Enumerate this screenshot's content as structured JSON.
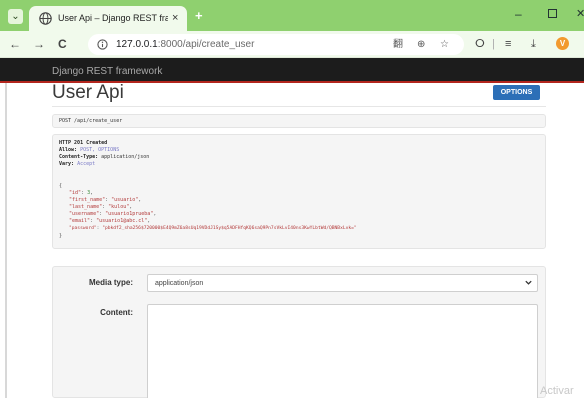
{
  "browser": {
    "tab_menu_glyph": "⌄",
    "tab_title": "User Api – Django REST framew",
    "tab_close": "×",
    "new_tab": "+",
    "window": {
      "minimize": "–",
      "close": "✕"
    },
    "nav": {
      "back": "←",
      "forward": "→",
      "reload": "C"
    },
    "url_host": "127.0.0.1",
    "url_rest": ":8000/api/create_user",
    "toolbar_icons": {
      "translate": "翻",
      "zoom": "⊕",
      "bookmark": "☆",
      "extensions": "ⵔ",
      "separator": "|",
      "reading_list": "≡",
      "downloads": "⤓",
      "profile": "V"
    }
  },
  "drf": {
    "brand": "Django REST framework",
    "page_title": "User Api",
    "options_button": "OPTIONS",
    "request_line": "POST /api/create_user",
    "response": {
      "status": "HTTP 201 Created",
      "headers": [
        {
          "name": "Allow:",
          "value": "POST, OPTIONS"
        },
        {
          "name": "Content-Type:",
          "value": "application/json"
        },
        {
          "name": "Vary:",
          "value": "Accept"
        }
      ],
      "open_brace": "{",
      "close_brace": "}",
      "fields": [
        {
          "key": "\"id\"",
          "value": "3"
        },
        {
          "key": "\"first_name\"",
          "value": "\"usuario\""
        },
        {
          "key": "\"last_name\"",
          "value": "\"kulou\""
        },
        {
          "key": "\"username\"",
          "value": "\"usuario1prueba\""
        },
        {
          "key": "\"email\"",
          "value": "\"usuario1@abc.cl\""
        },
        {
          "key": "\"password\"",
          "value": "\"pbkdf2_sha256$720000$E4Q9mZ6a8sUq19VDdJ1Sy$q5ADFHfqKQ6saQ9Pn7sVkLvI40ns3KwYLbtWd/QBNBxLvk=\""
        }
      ]
    },
    "form": {
      "media_type_label": "Media type:",
      "media_type_value": "application/json",
      "content_label": "Content:"
    }
  },
  "os_watermark": "Activar",
  "colors": {
    "tab_strip": "#8fd06f",
    "toolbar": "#f1faec",
    "drf_nav": "#1c1c1c",
    "drf_accent_red": "#b3261e",
    "options_blue": "#2c6fb7"
  }
}
